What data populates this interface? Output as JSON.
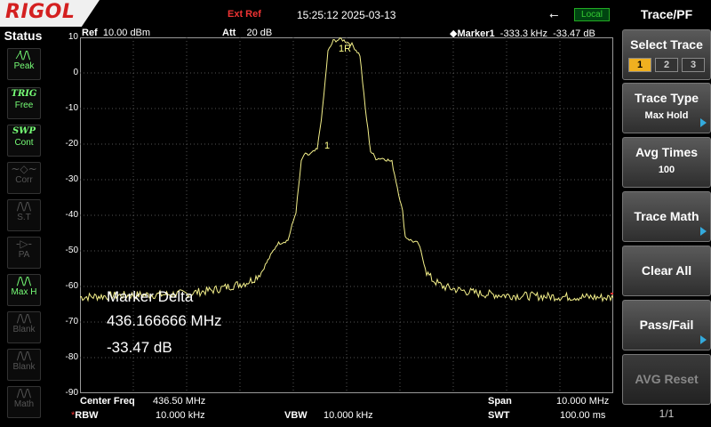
{
  "brand": "RIGOL",
  "header": {
    "ext_ref": "Ext Ref",
    "datetime": "15:25:12 2025-03-13",
    "usb_icon": "usb-icon",
    "local": "Local"
  },
  "status": {
    "title": "Status",
    "items": [
      {
        "icon": "peak-icon",
        "symbol": "⁄\\/\\",
        "label": "Peak",
        "active": true
      },
      {
        "icon": "trig-icon",
        "symbol": "TRIG",
        "label": "Free",
        "active": true
      },
      {
        "icon": "swp-icon",
        "symbol": "SWP",
        "label": "Cont",
        "active": true
      },
      {
        "icon": "corr-icon",
        "symbol": "~◇~",
        "label": "Corr",
        "active": false
      },
      {
        "icon": "st-icon",
        "symbol": "/\\/\\",
        "label": "S.T",
        "active": false
      },
      {
        "icon": "pa-icon",
        "symbol": "-▷-",
        "label": "PA",
        "active": false
      },
      {
        "icon": "maxh-icon",
        "symbol": "/\\/\\",
        "label": "Max H",
        "active": true
      },
      {
        "icon": "blank-icon",
        "symbol": "/\\/\\",
        "label": "Blank",
        "active": false
      },
      {
        "icon": "blank-icon",
        "symbol": "/\\/\\",
        "label": "Blank",
        "active": false
      },
      {
        "icon": "math-icon",
        "symbol": "/\\/\\",
        "label": "Math",
        "active": false
      }
    ]
  },
  "display": {
    "ref_label": "Ref",
    "ref_value": "10.00 dBm",
    "att_label": "Att",
    "att_value": "20 dB",
    "marker_label": "Marker1",
    "marker_value": "-333.3 kHz  -33.47 dB",
    "marker_delta_title": "Marker Delta",
    "marker_delta_freq": "436.166666 MHz",
    "marker_delta_level": "-33.47 dB",
    "marker1r_label": "1R",
    "marker1_label": "1",
    "center_label": "Center Freq",
    "center_value": "436.50 MHz",
    "span_label": "Span",
    "span_value": "10.000 MHz",
    "rbw_label": "RBW",
    "rbw_value": "10.000 kHz",
    "vbw_label": "VBW",
    "vbw_value": "10.000 kHz",
    "swt_label": "SWT",
    "swt_value": "100.00 ms"
  },
  "menu": {
    "title": "Trace/PF",
    "select_trace": "Select Trace",
    "traces": [
      "1",
      "2",
      "3"
    ],
    "trace_type": "Trace Type",
    "trace_type_value": "Max Hold",
    "avg_times": "Avg Times",
    "avg_times_value": "100",
    "trace_math": "Trace Math",
    "clear_all": "Clear All",
    "pass_fail": "Pass/Fail",
    "avg_reset": "AVG Reset",
    "page": "1/1"
  },
  "chart_data": {
    "type": "line",
    "ylim": [
      -90,
      10
    ],
    "yticks": [
      "10",
      "0",
      "-10",
      "-20",
      "-30",
      "-40",
      "-50",
      "-60",
      "-70",
      "-80",
      "-90"
    ],
    "xlim": [
      431.5,
      441.5
    ],
    "grid": true,
    "series": [
      {
        "color": "#f4f08a",
        "x": [
          431.5,
          432.3,
          433.0,
          433.5,
          434.0,
          434.3,
          434.6,
          434.75,
          434.9,
          435.2,
          435.4,
          435.55,
          435.65,
          435.7,
          435.8,
          435.95,
          436.05,
          436.15,
          436.25,
          436.4,
          436.6,
          436.75,
          436.85,
          436.95,
          437.05,
          437.2,
          437.35,
          437.55,
          437.6,
          437.7,
          437.85,
          438.0,
          438.1,
          438.3,
          438.6,
          439.0,
          439.5,
          440.2,
          441.0,
          441.5
        ],
        "y": [
          -63,
          -62.5,
          -62.3,
          -62,
          -61,
          -60,
          -59,
          -58,
          -56,
          -48,
          -47,
          -39,
          -25,
          -23,
          -23,
          -21.5,
          -10,
          6,
          9,
          9.5,
          8,
          5,
          -10,
          -22,
          -24,
          -24,
          -25,
          -39,
          -46,
          -47,
          -48,
          -56,
          -58,
          -60,
          -61,
          -62,
          -62.5,
          -62.8,
          -63,
          -63.2
        ]
      }
    ]
  }
}
